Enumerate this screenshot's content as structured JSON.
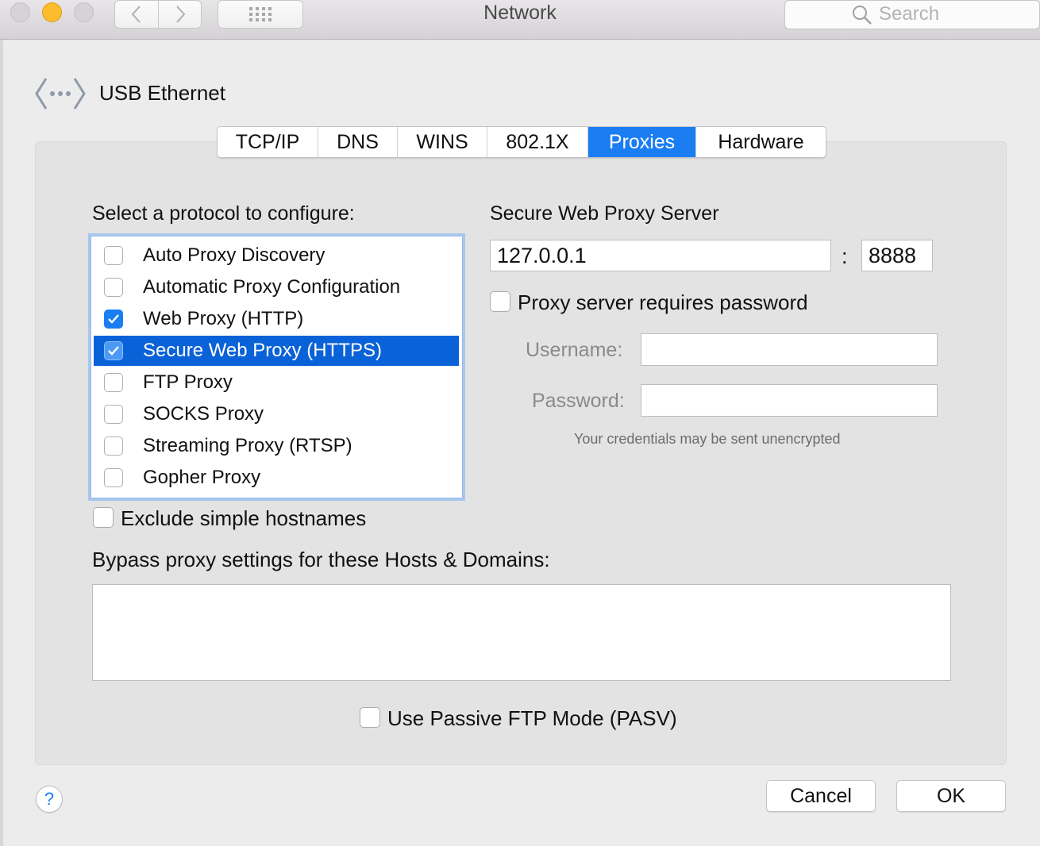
{
  "window": {
    "title": "Network",
    "search_placeholder": "Search"
  },
  "device": {
    "icon": "network-ethernet-icon",
    "name": "USB Ethernet"
  },
  "tabs": [
    {
      "label": "TCP/IP",
      "active": false
    },
    {
      "label": "DNS",
      "active": false
    },
    {
      "label": "WINS",
      "active": false
    },
    {
      "label": "802.1X",
      "active": false
    },
    {
      "label": "Proxies",
      "active": true
    },
    {
      "label": "Hardware",
      "active": false
    }
  ],
  "protocols": {
    "heading": "Select a protocol to configure:",
    "items": [
      {
        "label": "Auto Proxy Discovery",
        "checked": false,
        "selected": false
      },
      {
        "label": "Automatic Proxy Configuration",
        "checked": false,
        "selected": false
      },
      {
        "label": "Web Proxy (HTTP)",
        "checked": true,
        "selected": false
      },
      {
        "label": "Secure Web Proxy (HTTPS)",
        "checked": true,
        "selected": true
      },
      {
        "label": "FTP Proxy",
        "checked": false,
        "selected": false
      },
      {
        "label": "SOCKS Proxy",
        "checked": false,
        "selected": false
      },
      {
        "label": "Streaming Proxy (RTSP)",
        "checked": false,
        "selected": false
      },
      {
        "label": "Gopher Proxy",
        "checked": false,
        "selected": false
      }
    ]
  },
  "server": {
    "heading": "Secure Web Proxy Server",
    "host": "127.0.0.1",
    "separator": ":",
    "port": "8888",
    "requires_password_label": "Proxy server requires password",
    "requires_password": false,
    "username_label": "Username:",
    "username": "",
    "password_label": "Password:",
    "password": "",
    "note": "Your credentials may be sent unencrypted"
  },
  "exclude_simple_hostnames": {
    "label": "Exclude simple hostnames",
    "checked": false
  },
  "bypass": {
    "heading": "Bypass proxy settings for these Hosts & Domains:",
    "value": ""
  },
  "passive_ftp": {
    "label": "Use Passive FTP Mode (PASV)",
    "checked": false
  },
  "footer": {
    "help": "?",
    "cancel_label": "Cancel",
    "ok_label": "OK"
  }
}
